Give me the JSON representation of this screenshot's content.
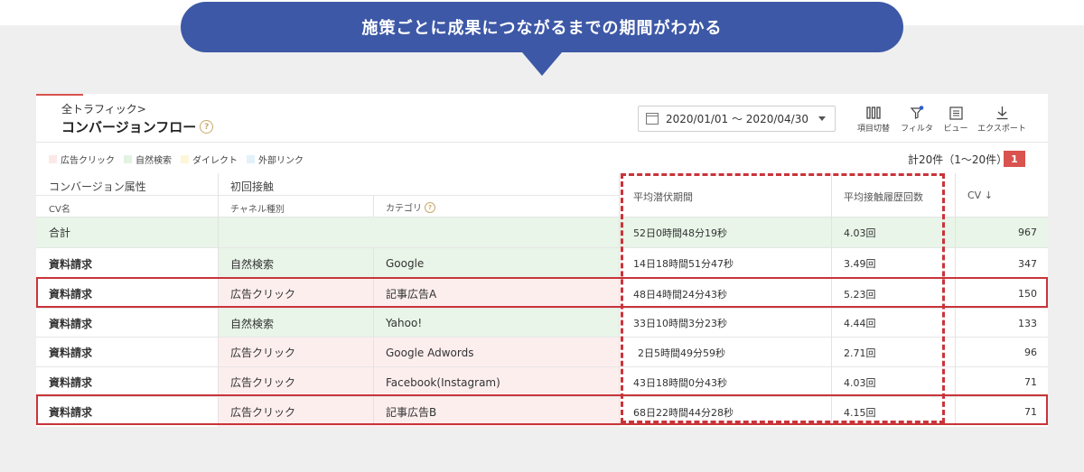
{
  "banner": {
    "text": "施策ごとに成果につながるまでの期間がわかる"
  },
  "header": {
    "breadcrumb": "全トラフィック>",
    "title": "コンバージョンフロー",
    "help_glyph": "?",
    "date_range": "2020/01/01 〜 2020/04/30"
  },
  "toolbar": {
    "columns_label": "項目切替",
    "filter_label": "フィルタ",
    "view_label": "ビュー",
    "export_label": "エクスポート"
  },
  "legend": [
    {
      "label": "広告クリック",
      "color": "#fde8e8"
    },
    {
      "label": "自然検索",
      "color": "#e3f3e3"
    },
    {
      "label": "ダイレクト",
      "color": "#fdf6d8"
    },
    {
      "label": "外部リンク",
      "color": "#e3f1fb"
    }
  ],
  "pagination": {
    "count_text": "計20件（1〜20件）",
    "current_page": "1"
  },
  "table": {
    "group_headers": {
      "cv_attr": "コンバージョン属性",
      "first_touch": "初回接触"
    },
    "sub_headers": {
      "cv_name": "CV名",
      "channel": "チャネル種別",
      "category": "カテゴリ"
    },
    "metric_headers": {
      "avg_latency": "平均潜伏期間",
      "avg_touches": "平均接触履歴回数",
      "cv": "CV ↓"
    },
    "total": {
      "name": "合計",
      "latency": "52日0時間48分19秒",
      "touches": "4.03回",
      "cv": "967"
    },
    "rows": [
      {
        "name": "資料請求",
        "channel": "自然検索",
        "category": "Google",
        "latency": "14日18時間51分47秒",
        "touches": "3.49回",
        "cv": "347"
      },
      {
        "name": "資料請求",
        "channel": "広告クリック",
        "category": "記事広告A",
        "latency": "48日4時間24分43秒",
        "touches": "5.23回",
        "cv": "150"
      },
      {
        "name": "資料請求",
        "channel": "自然検索",
        "category": "Yahoo!",
        "latency": "33日10時間3分23秒",
        "touches": "4.44回",
        "cv": "133"
      },
      {
        "name": "資料請求",
        "channel": "広告クリック",
        "category": "Google Adwords",
        "latency": "2日5時間49分59秒",
        "touches": "2.71回",
        "cv": "96"
      },
      {
        "name": "資料請求",
        "channel": "広告クリック",
        "category": "Facebook(Instagram)",
        "latency": "43日18時間0分43秒",
        "touches": "4.03回",
        "cv": "71"
      },
      {
        "name": "資料請求",
        "channel": "広告クリック",
        "category": "記事広告B",
        "latency": "68日22時間44分28秒",
        "touches": "4.15回",
        "cv": "71"
      }
    ]
  }
}
